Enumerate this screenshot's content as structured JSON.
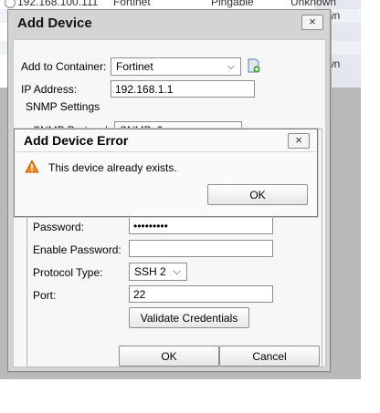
{
  "background_table": {
    "rows": [
      {
        "ip": "192.168.100.111",
        "vendor": "Fortinet",
        "status": "Pingable",
        "extra": "Unknown"
      },
      {
        "ip": "",
        "vendor": "",
        "status": "",
        "extra": "wn"
      },
      {
        "ip": "",
        "vendor": "",
        "status": "",
        "extra": "wn"
      }
    ]
  },
  "add_device": {
    "title": "Add Device",
    "close_label": "×",
    "container_label": "Add to Container:",
    "container_value": "Fortinet",
    "ip_label": "IP Address:",
    "ip_value": "192.168.1.1",
    "snmp_legend": "SNMP Settings",
    "snmp_protocol_label": "SNMP Protocol:",
    "snmp_protocol_value": "SNMPv2c",
    "password_label": "Password:",
    "password_value": "•••••••••",
    "enable_password_label": "Enable Password:",
    "enable_password_value": "",
    "protocol_type_label": "Protocol Type:",
    "protocol_type_value": "SSH 2",
    "port_label": "Port:",
    "port_value": "22",
    "validate_label": "Validate Credentials",
    "ok_label": "OK",
    "cancel_label": "Cancel"
  },
  "error_dialog": {
    "title": "Add Device Error",
    "close_label": "×",
    "message": "This device already exists.",
    "ok_label": "OK"
  },
  "icons": {
    "add_container": "add-container-icon",
    "warning": "warning-icon"
  }
}
